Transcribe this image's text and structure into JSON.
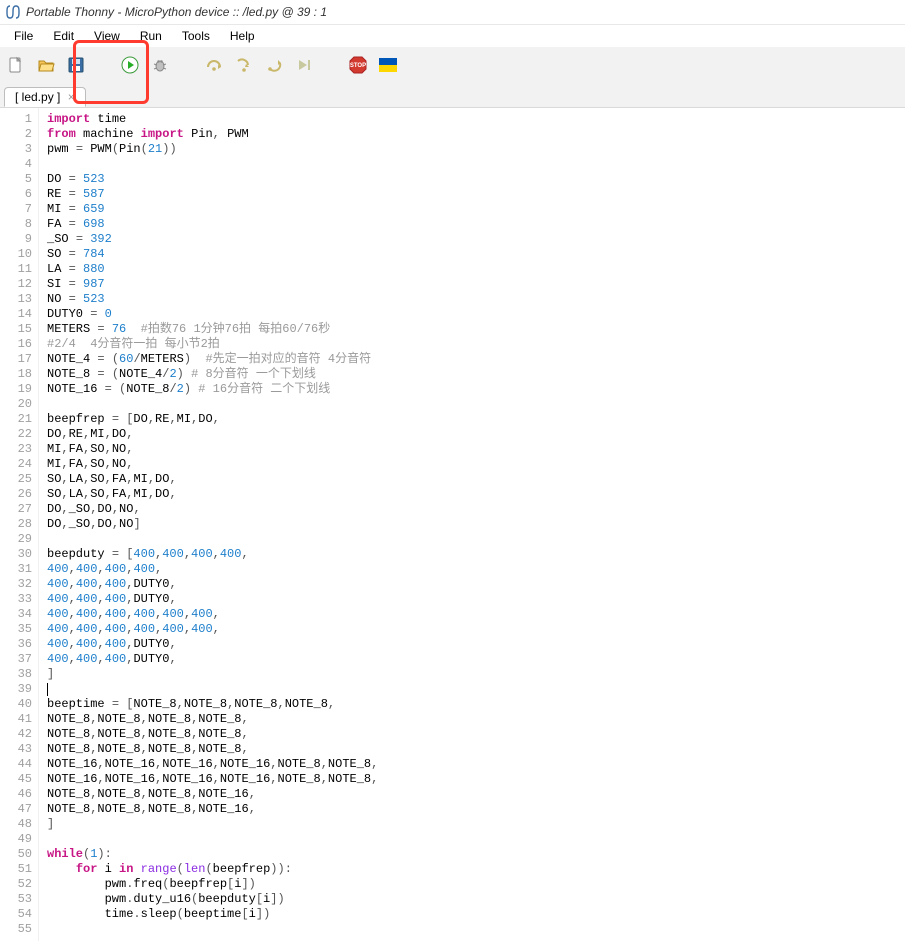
{
  "window": {
    "title": "Portable Thonny  -  MicroPython device :: /led.py  @  39 : 1"
  },
  "menu": {
    "file": "File",
    "edit": "Edit",
    "view": "View",
    "run": "Run",
    "tools": "Tools",
    "help": "Help"
  },
  "toolbar": {
    "new": "new-file-icon",
    "open": "open-folder-icon",
    "save": "save-icon",
    "run": "run-icon",
    "debug": "debug-icon",
    "step_over": "step-over-icon",
    "step_into": "step-into-icon",
    "step_out": "step-out-icon",
    "resume": "resume-icon",
    "stop": "stop-icon",
    "flag": "ukraine-flag-icon"
  },
  "tabs": {
    "active": "[ led.py ]",
    "close": "×"
  },
  "gutter_start": 1,
  "code": [
    [
      [
        "kw",
        "import"
      ],
      [
        "sp",
        " "
      ],
      [
        "id",
        "time"
      ]
    ],
    [
      [
        "kw",
        "from"
      ],
      [
        "sp",
        " "
      ],
      [
        "id",
        "machine"
      ],
      [
        "sp",
        " "
      ],
      [
        "kw",
        "import"
      ],
      [
        "sp",
        " "
      ],
      [
        "id",
        "Pin"
      ],
      [
        "op",
        ","
      ],
      [
        "sp",
        " "
      ],
      [
        "id",
        "PWM"
      ]
    ],
    [
      [
        "id",
        "pwm"
      ],
      [
        "sp",
        " "
      ],
      [
        "op",
        "="
      ],
      [
        "sp",
        " "
      ],
      [
        "fn",
        "PWM"
      ],
      [
        "op",
        "("
      ],
      [
        "fn",
        "Pin"
      ],
      [
        "op",
        "("
      ],
      [
        "num",
        "21"
      ],
      [
        "op",
        ")"
      ],
      [
        "op",
        ")"
      ]
    ],
    [],
    [
      [
        "id",
        "DO"
      ],
      [
        "sp",
        " "
      ],
      [
        "op",
        "="
      ],
      [
        "sp",
        " "
      ],
      [
        "num",
        "523"
      ]
    ],
    [
      [
        "id",
        "RE"
      ],
      [
        "sp",
        " "
      ],
      [
        "op",
        "="
      ],
      [
        "sp",
        " "
      ],
      [
        "num",
        "587"
      ]
    ],
    [
      [
        "id",
        "MI"
      ],
      [
        "sp",
        " "
      ],
      [
        "op",
        "="
      ],
      [
        "sp",
        " "
      ],
      [
        "num",
        "659"
      ]
    ],
    [
      [
        "id",
        "FA"
      ],
      [
        "sp",
        " "
      ],
      [
        "op",
        "="
      ],
      [
        "sp",
        " "
      ],
      [
        "num",
        "698"
      ]
    ],
    [
      [
        "id",
        "_SO"
      ],
      [
        "sp",
        " "
      ],
      [
        "op",
        "="
      ],
      [
        "sp",
        " "
      ],
      [
        "num",
        "392"
      ]
    ],
    [
      [
        "id",
        "SO"
      ],
      [
        "sp",
        " "
      ],
      [
        "op",
        "="
      ],
      [
        "sp",
        " "
      ],
      [
        "num",
        "784"
      ]
    ],
    [
      [
        "id",
        "LA"
      ],
      [
        "sp",
        " "
      ],
      [
        "op",
        "="
      ],
      [
        "sp",
        " "
      ],
      [
        "num",
        "880"
      ]
    ],
    [
      [
        "id",
        "SI"
      ],
      [
        "sp",
        " "
      ],
      [
        "op",
        "="
      ],
      [
        "sp",
        " "
      ],
      [
        "num",
        "987"
      ]
    ],
    [
      [
        "id",
        "NO"
      ],
      [
        "sp",
        " "
      ],
      [
        "op",
        "="
      ],
      [
        "sp",
        " "
      ],
      [
        "num",
        "523"
      ]
    ],
    [
      [
        "id",
        "DUTY0"
      ],
      [
        "sp",
        " "
      ],
      [
        "op",
        "="
      ],
      [
        "sp",
        " "
      ],
      [
        "num",
        "0"
      ]
    ],
    [
      [
        "id",
        "METERS"
      ],
      [
        "sp",
        " "
      ],
      [
        "op",
        "="
      ],
      [
        "sp",
        " "
      ],
      [
        "num",
        "76"
      ],
      [
        "sp",
        "  "
      ],
      [
        "cmt",
        "#拍数76 1分钟76拍 每拍60/76秒"
      ]
    ],
    [
      [
        "cmt",
        "#2/4  4分音符一拍 每小节2拍"
      ]
    ],
    [
      [
        "id",
        "NOTE_4"
      ],
      [
        "sp",
        " "
      ],
      [
        "op",
        "="
      ],
      [
        "sp",
        " "
      ],
      [
        "op",
        "("
      ],
      [
        "num",
        "60"
      ],
      [
        "op",
        "/"
      ],
      [
        "id",
        "METERS"
      ],
      [
        "op",
        ")"
      ],
      [
        "sp",
        "  "
      ],
      [
        "cmt",
        "#先定一拍对应的音符 4分音符"
      ]
    ],
    [
      [
        "id",
        "NOTE_8"
      ],
      [
        "sp",
        " "
      ],
      [
        "op",
        "="
      ],
      [
        "sp",
        " "
      ],
      [
        "op",
        "("
      ],
      [
        "id",
        "NOTE_4"
      ],
      [
        "op",
        "/"
      ],
      [
        "num",
        "2"
      ],
      [
        "op",
        ")"
      ],
      [
        "sp",
        " "
      ],
      [
        "cmt",
        "# 8分音符 一个下划线"
      ]
    ],
    [
      [
        "id",
        "NOTE_16"
      ],
      [
        "sp",
        " "
      ],
      [
        "op",
        "="
      ],
      [
        "sp",
        " "
      ],
      [
        "op",
        "("
      ],
      [
        "id",
        "NOTE_8"
      ],
      [
        "op",
        "/"
      ],
      [
        "num",
        "2"
      ],
      [
        "op",
        ")"
      ],
      [
        "sp",
        " "
      ],
      [
        "cmt",
        "# 16分音符 二个下划线"
      ]
    ],
    [],
    [
      [
        "id",
        "beepfrep"
      ],
      [
        "sp",
        " "
      ],
      [
        "op",
        "="
      ],
      [
        "sp",
        " "
      ],
      [
        "op",
        "["
      ],
      [
        "id",
        "DO"
      ],
      [
        "op",
        ","
      ],
      [
        "id",
        "RE"
      ],
      [
        "op",
        ","
      ],
      [
        "id",
        "MI"
      ],
      [
        "op",
        ","
      ],
      [
        "id",
        "DO"
      ],
      [
        "op",
        ","
      ]
    ],
    [
      [
        "id",
        "DO"
      ],
      [
        "op",
        ","
      ],
      [
        "id",
        "RE"
      ],
      [
        "op",
        ","
      ],
      [
        "id",
        "MI"
      ],
      [
        "op",
        ","
      ],
      [
        "id",
        "DO"
      ],
      [
        "op",
        ","
      ]
    ],
    [
      [
        "id",
        "MI"
      ],
      [
        "op",
        ","
      ],
      [
        "id",
        "FA"
      ],
      [
        "op",
        ","
      ],
      [
        "id",
        "SO"
      ],
      [
        "op",
        ","
      ],
      [
        "id",
        "NO"
      ],
      [
        "op",
        ","
      ]
    ],
    [
      [
        "id",
        "MI"
      ],
      [
        "op",
        ","
      ],
      [
        "id",
        "FA"
      ],
      [
        "op",
        ","
      ],
      [
        "id",
        "SO"
      ],
      [
        "op",
        ","
      ],
      [
        "id",
        "NO"
      ],
      [
        "op",
        ","
      ]
    ],
    [
      [
        "id",
        "SO"
      ],
      [
        "op",
        ","
      ],
      [
        "id",
        "LA"
      ],
      [
        "op",
        ","
      ],
      [
        "id",
        "SO"
      ],
      [
        "op",
        ","
      ],
      [
        "id",
        "FA"
      ],
      [
        "op",
        ","
      ],
      [
        "id",
        "MI"
      ],
      [
        "op",
        ","
      ],
      [
        "id",
        "DO"
      ],
      [
        "op",
        ","
      ]
    ],
    [
      [
        "id",
        "SO"
      ],
      [
        "op",
        ","
      ],
      [
        "id",
        "LA"
      ],
      [
        "op",
        ","
      ],
      [
        "id",
        "SO"
      ],
      [
        "op",
        ","
      ],
      [
        "id",
        "FA"
      ],
      [
        "op",
        ","
      ],
      [
        "id",
        "MI"
      ],
      [
        "op",
        ","
      ],
      [
        "id",
        "DO"
      ],
      [
        "op",
        ","
      ]
    ],
    [
      [
        "id",
        "DO"
      ],
      [
        "op",
        ","
      ],
      [
        "id",
        "_SO"
      ],
      [
        "op",
        ","
      ],
      [
        "id",
        "DO"
      ],
      [
        "op",
        ","
      ],
      [
        "id",
        "NO"
      ],
      [
        "op",
        ","
      ]
    ],
    [
      [
        "id",
        "DO"
      ],
      [
        "op",
        ","
      ],
      [
        "id",
        "_SO"
      ],
      [
        "op",
        ","
      ],
      [
        "id",
        "DO"
      ],
      [
        "op",
        ","
      ],
      [
        "id",
        "NO"
      ],
      [
        "op",
        "]"
      ]
    ],
    [],
    [
      [
        "id",
        "beepduty"
      ],
      [
        "sp",
        " "
      ],
      [
        "op",
        "="
      ],
      [
        "sp",
        " "
      ],
      [
        "op",
        "["
      ],
      [
        "num",
        "400"
      ],
      [
        "op",
        ","
      ],
      [
        "num",
        "400"
      ],
      [
        "op",
        ","
      ],
      [
        "num",
        "400"
      ],
      [
        "op",
        ","
      ],
      [
        "num",
        "400"
      ],
      [
        "op",
        ","
      ]
    ],
    [
      [
        "num",
        "400"
      ],
      [
        "op",
        ","
      ],
      [
        "num",
        "400"
      ],
      [
        "op",
        ","
      ],
      [
        "num",
        "400"
      ],
      [
        "op",
        ","
      ],
      [
        "num",
        "400"
      ],
      [
        "op",
        ","
      ]
    ],
    [
      [
        "num",
        "400"
      ],
      [
        "op",
        ","
      ],
      [
        "num",
        "400"
      ],
      [
        "op",
        ","
      ],
      [
        "num",
        "400"
      ],
      [
        "op",
        ","
      ],
      [
        "id",
        "DUTY0"
      ],
      [
        "op",
        ","
      ]
    ],
    [
      [
        "num",
        "400"
      ],
      [
        "op",
        ","
      ],
      [
        "num",
        "400"
      ],
      [
        "op",
        ","
      ],
      [
        "num",
        "400"
      ],
      [
        "op",
        ","
      ],
      [
        "id",
        "DUTY0"
      ],
      [
        "op",
        ","
      ]
    ],
    [
      [
        "num",
        "400"
      ],
      [
        "op",
        ","
      ],
      [
        "num",
        "400"
      ],
      [
        "op",
        ","
      ],
      [
        "num",
        "400"
      ],
      [
        "op",
        ","
      ],
      [
        "num",
        "400"
      ],
      [
        "op",
        ","
      ],
      [
        "num",
        "400"
      ],
      [
        "op",
        ","
      ],
      [
        "num",
        "400"
      ],
      [
        "op",
        ","
      ]
    ],
    [
      [
        "num",
        "400"
      ],
      [
        "op",
        ","
      ],
      [
        "num",
        "400"
      ],
      [
        "op",
        ","
      ],
      [
        "num",
        "400"
      ],
      [
        "op",
        ","
      ],
      [
        "num",
        "400"
      ],
      [
        "op",
        ","
      ],
      [
        "num",
        "400"
      ],
      [
        "op",
        ","
      ],
      [
        "num",
        "400"
      ],
      [
        "op",
        ","
      ]
    ],
    [
      [
        "num",
        "400"
      ],
      [
        "op",
        ","
      ],
      [
        "num",
        "400"
      ],
      [
        "op",
        ","
      ],
      [
        "num",
        "400"
      ],
      [
        "op",
        ","
      ],
      [
        "id",
        "DUTY0"
      ],
      [
        "op",
        ","
      ]
    ],
    [
      [
        "num",
        "400"
      ],
      [
        "op",
        ","
      ],
      [
        "num",
        "400"
      ],
      [
        "op",
        ","
      ],
      [
        "num",
        "400"
      ],
      [
        "op",
        ","
      ],
      [
        "id",
        "DUTY0"
      ],
      [
        "op",
        ","
      ]
    ],
    [
      [
        "op",
        "]"
      ]
    ],
    [
      [
        "caret",
        ""
      ]
    ],
    [
      [
        "id",
        "beeptime"
      ],
      [
        "sp",
        " "
      ],
      [
        "op",
        "="
      ],
      [
        "sp",
        " "
      ],
      [
        "op",
        "["
      ],
      [
        "id",
        "NOTE_8"
      ],
      [
        "op",
        ","
      ],
      [
        "id",
        "NOTE_8"
      ],
      [
        "op",
        ","
      ],
      [
        "id",
        "NOTE_8"
      ],
      [
        "op",
        ","
      ],
      [
        "id",
        "NOTE_8"
      ],
      [
        "op",
        ","
      ]
    ],
    [
      [
        "id",
        "NOTE_8"
      ],
      [
        "op",
        ","
      ],
      [
        "id",
        "NOTE_8"
      ],
      [
        "op",
        ","
      ],
      [
        "id",
        "NOTE_8"
      ],
      [
        "op",
        ","
      ],
      [
        "id",
        "NOTE_8"
      ],
      [
        "op",
        ","
      ]
    ],
    [
      [
        "id",
        "NOTE_8"
      ],
      [
        "op",
        ","
      ],
      [
        "id",
        "NOTE_8"
      ],
      [
        "op",
        ","
      ],
      [
        "id",
        "NOTE_8"
      ],
      [
        "op",
        ","
      ],
      [
        "id",
        "NOTE_8"
      ],
      [
        "op",
        ","
      ]
    ],
    [
      [
        "id",
        "NOTE_8"
      ],
      [
        "op",
        ","
      ],
      [
        "id",
        "NOTE_8"
      ],
      [
        "op",
        ","
      ],
      [
        "id",
        "NOTE_8"
      ],
      [
        "op",
        ","
      ],
      [
        "id",
        "NOTE_8"
      ],
      [
        "op",
        ","
      ]
    ],
    [
      [
        "id",
        "NOTE_16"
      ],
      [
        "op",
        ","
      ],
      [
        "id",
        "NOTE_16"
      ],
      [
        "op",
        ","
      ],
      [
        "id",
        "NOTE_16"
      ],
      [
        "op",
        ","
      ],
      [
        "id",
        "NOTE_16"
      ],
      [
        "op",
        ","
      ],
      [
        "id",
        "NOTE_8"
      ],
      [
        "op",
        ","
      ],
      [
        "id",
        "NOTE_8"
      ],
      [
        "op",
        ","
      ]
    ],
    [
      [
        "id",
        "NOTE_16"
      ],
      [
        "op",
        ","
      ],
      [
        "id",
        "NOTE_16"
      ],
      [
        "op",
        ","
      ],
      [
        "id",
        "NOTE_16"
      ],
      [
        "op",
        ","
      ],
      [
        "id",
        "NOTE_16"
      ],
      [
        "op",
        ","
      ],
      [
        "id",
        "NOTE_8"
      ],
      [
        "op",
        ","
      ],
      [
        "id",
        "NOTE_8"
      ],
      [
        "op",
        ","
      ]
    ],
    [
      [
        "id",
        "NOTE_8"
      ],
      [
        "op",
        ","
      ],
      [
        "id",
        "NOTE_8"
      ],
      [
        "op",
        ","
      ],
      [
        "id",
        "NOTE_8"
      ],
      [
        "op",
        ","
      ],
      [
        "id",
        "NOTE_16"
      ],
      [
        "op",
        ","
      ]
    ],
    [
      [
        "id",
        "NOTE_8"
      ],
      [
        "op",
        ","
      ],
      [
        "id",
        "NOTE_8"
      ],
      [
        "op",
        ","
      ],
      [
        "id",
        "NOTE_8"
      ],
      [
        "op",
        ","
      ],
      [
        "id",
        "NOTE_16"
      ],
      [
        "op",
        ","
      ]
    ],
    [
      [
        "op",
        "]"
      ]
    ],
    [],
    [
      [
        "kw",
        "while"
      ],
      [
        "op",
        "("
      ],
      [
        "num",
        "1"
      ],
      [
        "op",
        ")"
      ],
      [
        "op",
        ":"
      ]
    ],
    [
      [
        "sp",
        "    "
      ],
      [
        "kw",
        "for"
      ],
      [
        "sp",
        " "
      ],
      [
        "id",
        "i"
      ],
      [
        "sp",
        " "
      ],
      [
        "kw",
        "in"
      ],
      [
        "sp",
        " "
      ],
      [
        "builtin",
        "range"
      ],
      [
        "op",
        "("
      ],
      [
        "builtin",
        "len"
      ],
      [
        "op",
        "("
      ],
      [
        "id",
        "beepfrep"
      ],
      [
        "op",
        ")"
      ],
      [
        "op",
        ")"
      ],
      [
        "op",
        ":"
      ]
    ],
    [
      [
        "sp",
        "        "
      ],
      [
        "id",
        "pwm"
      ],
      [
        "op",
        "."
      ],
      [
        "fn",
        "freq"
      ],
      [
        "op",
        "("
      ],
      [
        "id",
        "beepfrep"
      ],
      [
        "op",
        "["
      ],
      [
        "id",
        "i"
      ],
      [
        "op",
        "]"
      ],
      [
        "op",
        ")"
      ]
    ],
    [
      [
        "sp",
        "        "
      ],
      [
        "id",
        "pwm"
      ],
      [
        "op",
        "."
      ],
      [
        "fn",
        "duty_u16"
      ],
      [
        "op",
        "("
      ],
      [
        "id",
        "beepduty"
      ],
      [
        "op",
        "["
      ],
      [
        "id",
        "i"
      ],
      [
        "op",
        "]"
      ],
      [
        "op",
        ")"
      ]
    ],
    [
      [
        "sp",
        "        "
      ],
      [
        "id",
        "time"
      ],
      [
        "op",
        "."
      ],
      [
        "fn",
        "sleep"
      ],
      [
        "op",
        "("
      ],
      [
        "id",
        "beeptime"
      ],
      [
        "op",
        "["
      ],
      [
        "id",
        "i"
      ],
      [
        "op",
        "]"
      ],
      [
        "op",
        ")"
      ]
    ],
    []
  ]
}
